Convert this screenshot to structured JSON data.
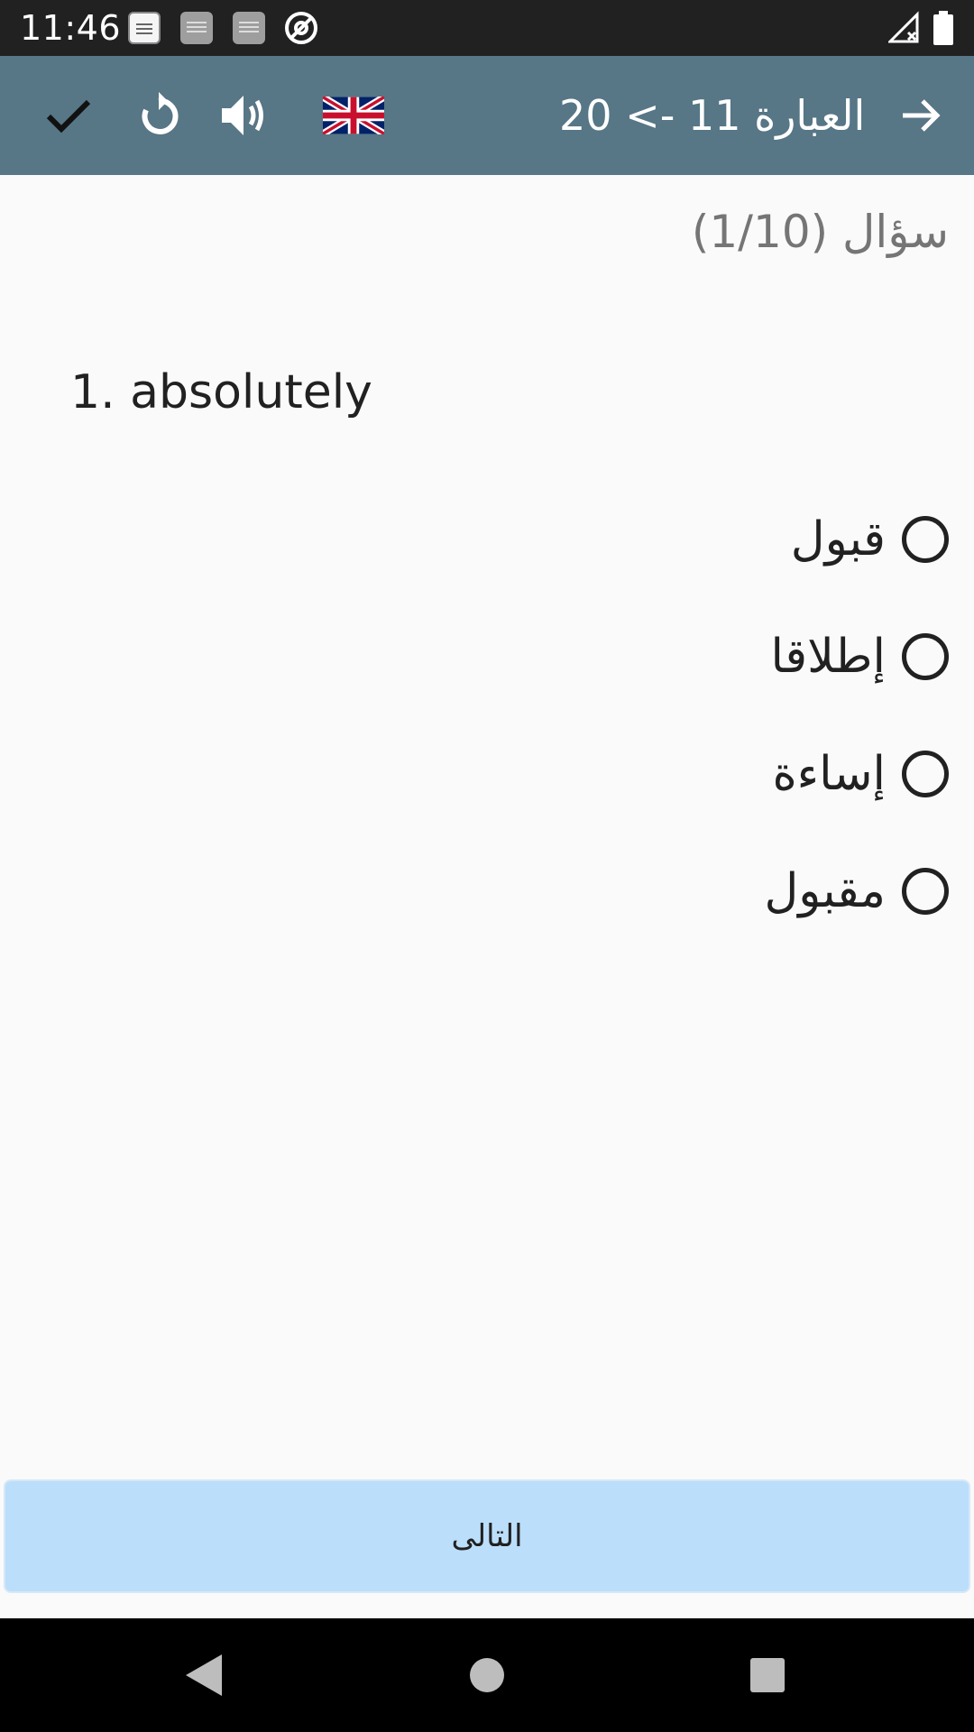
{
  "status_bar": {
    "time": "11:46",
    "notification_icons": [
      "app-notification-icon",
      "app-notification-icon",
      "app-notification-icon",
      "at-sign-icon"
    ],
    "system_icons": [
      "no-signal-icon",
      "battery-full-icon"
    ]
  },
  "toolbar": {
    "title": "العبارة 11 -> 20",
    "actions": [
      "check-icon",
      "refresh-icon",
      "volume-icon",
      "uk-flag-icon",
      "arrow-forward-icon"
    ]
  },
  "quiz": {
    "counter": "سؤال (1/10)",
    "word": "1. absolutely",
    "options": [
      {
        "label": "قبول",
        "selected": false
      },
      {
        "label": "إطلاقا",
        "selected": false
      },
      {
        "label": "إساءة",
        "selected": false
      },
      {
        "label": "مقبول",
        "selected": false
      }
    ]
  },
  "next_button": {
    "label": "التالى"
  },
  "colors": {
    "app_bar": "#577686",
    "status_bar": "#212121",
    "button_bg": "#bbdefb",
    "background": "#fafafa"
  }
}
